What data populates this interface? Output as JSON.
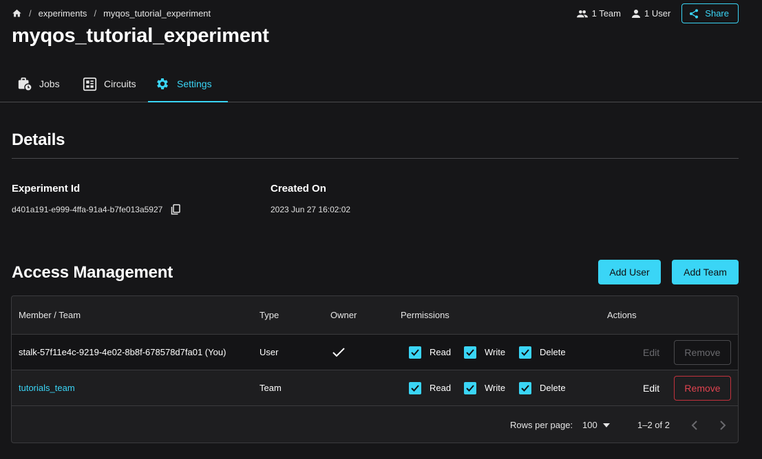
{
  "breadcrumb": {
    "items": [
      "experiments",
      "myqos_tutorial_experiment"
    ],
    "separator": "/"
  },
  "header": {
    "title": "myqos_tutorial_experiment",
    "team_count": "1 Team",
    "user_count": "1 User",
    "share_label": "Share"
  },
  "tabs": [
    {
      "label": "Jobs",
      "icon": "briefcase-clock-icon"
    },
    {
      "label": "Circuits",
      "icon": "circuit-board-icon"
    },
    {
      "label": "Settings",
      "icon": "gear-icon",
      "active": true
    }
  ],
  "details": {
    "heading": "Details",
    "experiment_id_label": "Experiment Id",
    "experiment_id": "d401a191-e999-4ffa-91a4-b7fe013a5927",
    "created_on_label": "Created On",
    "created_on": "2023 Jun 27 16:02:02"
  },
  "access": {
    "heading": "Access Management",
    "add_user_label": "Add User",
    "add_team_label": "Add Team",
    "columns": [
      "Member / Team",
      "Type",
      "Owner",
      "Permissions",
      "Actions"
    ],
    "rows": [
      {
        "member": "stalk-57f11e4c-9219-4e02-8b8f-678578d7fa01 (You)",
        "type": "User",
        "owner": true,
        "permissions": [
          "Read",
          "Write",
          "Delete"
        ],
        "edit_label": "Edit",
        "remove_label": "Remove",
        "actions_enabled": false
      },
      {
        "member": "tutorials_team",
        "type": "Team",
        "owner": false,
        "permissions": [
          "Read",
          "Write",
          "Delete"
        ],
        "edit_label": "Edit",
        "remove_label": "Remove",
        "actions_enabled": true
      }
    ],
    "pagination": {
      "rows_per_page_label": "Rows per page:",
      "rows_per_page": "100",
      "range": "1–2 of 2"
    }
  },
  "colors": {
    "accent": "#3ad5f6",
    "danger": "#e0434f",
    "background": "#161618"
  }
}
